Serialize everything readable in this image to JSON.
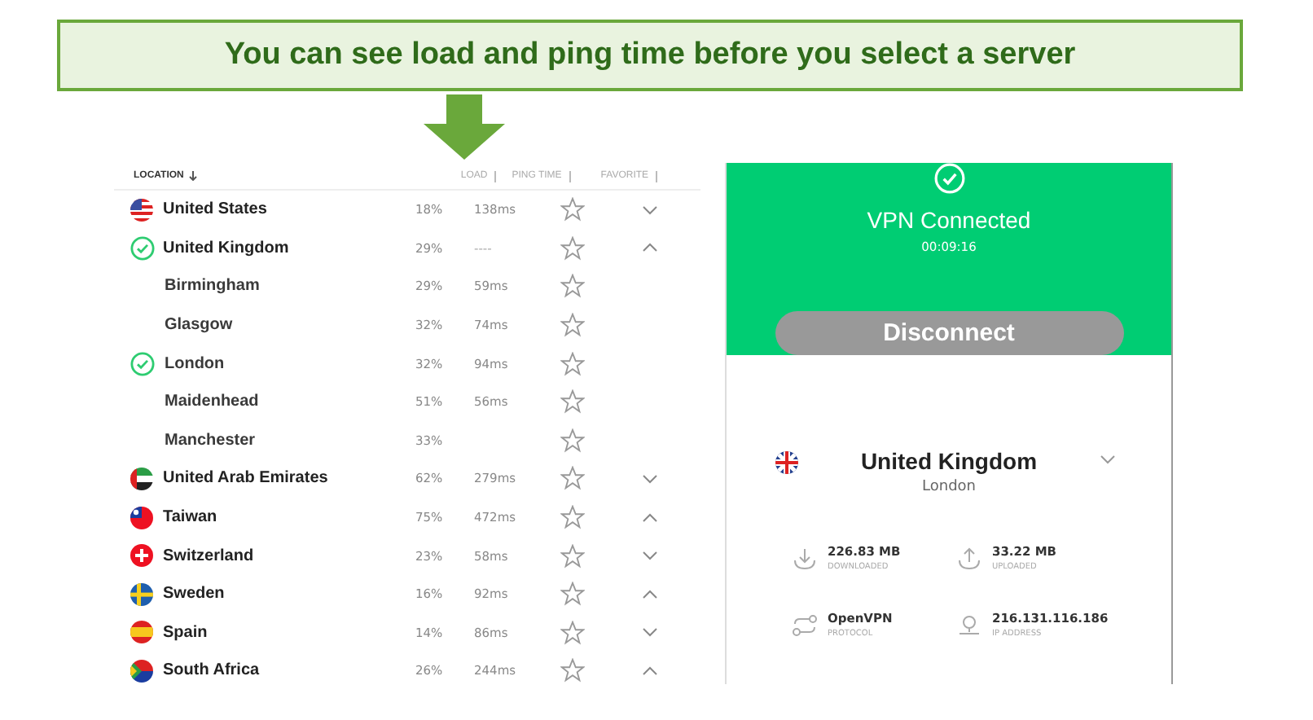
{
  "banner": {
    "text": "You can see load and ping time before you select a server"
  },
  "table": {
    "columns": [
      "LOCATION",
      "LOAD",
      "PING TIME",
      "FAVORITE"
    ],
    "rows": [
      {
        "kind": "country",
        "flag": {
          "kind": "us"
        },
        "name": "United States",
        "load": "18%",
        "ping": "138ms",
        "favorite": false,
        "connected": false,
        "expanded": false
      },
      {
        "kind": "country",
        "name": "United Kingdom",
        "load": "29%",
        "ping": "----",
        "favorite": false,
        "connected": true,
        "expanded": true,
        "children": [
          {
            "kind": "city",
            "name": "Birmingham",
            "load": "29%",
            "ping": "59ms",
            "favorite": false,
            "connected": false
          },
          {
            "kind": "city",
            "name": "Glasgow",
            "load": "32%",
            "ping": "74ms",
            "favorite": false,
            "connected": false
          },
          {
            "kind": "city",
            "name": "London",
            "load": "32%",
            "ping": "94ms",
            "favorite": false,
            "connected": true
          },
          {
            "kind": "city",
            "name": "Maidenhead",
            "load": "51%",
            "ping": "56ms",
            "favorite": false,
            "connected": false
          },
          {
            "kind": "city",
            "name": "Manchester",
            "load": "33%",
            "favorite": false,
            "connected": false
          }
        ]
      },
      {
        "kind": "country",
        "flag": {
          "kind": "ae"
        },
        "name": "United Arab Emirates",
        "load": "62%",
        "ping": "279ms",
        "favorite": false,
        "connected": false,
        "expanded": false
      },
      {
        "kind": "country",
        "flag": {
          "kind": "tw"
        },
        "name": "Taiwan",
        "load": "75%",
        "ping": "472ms",
        "favorite": false,
        "connected": false,
        "expanded": true
      },
      {
        "kind": "country",
        "flag": {
          "kind": "ch"
        },
        "name": "Switzerland",
        "load": "23%",
        "ping": "58ms",
        "favorite": false,
        "connected": false,
        "expanded": false
      },
      {
        "kind": "country",
        "flag": {
          "kind": "se"
        },
        "name": "Sweden",
        "load": "16%",
        "ping": "92ms",
        "favorite": false,
        "connected": false,
        "expanded": true
      },
      {
        "kind": "country",
        "flag": {
          "kind": "es"
        },
        "name": "Spain",
        "load": "14%",
        "ping": "86ms",
        "favorite": false,
        "connected": false,
        "expanded": false
      },
      {
        "kind": "country",
        "flag": {
          "kind": "za"
        },
        "name": "South Africa",
        "load": "26%",
        "ping": "244ms",
        "favorite": false,
        "connected": false,
        "expanded": true
      }
    ]
  },
  "status": {
    "title": "VPN Connected",
    "time": "00:09:16",
    "button": "Disconnect"
  },
  "location": {
    "flag": {
      "kind": "uk"
    },
    "country": "United Kingdom",
    "city": "London"
  },
  "stats": [
    {
      "kind": "download",
      "value": "226.83 MB",
      "label": "DOWNLOADED"
    },
    {
      "kind": "upload",
      "value": "33.22 MB",
      "label": "UPLOADED"
    },
    {
      "kind": "protocol",
      "value": "OpenVPN",
      "label": "PROTOCOL"
    },
    {
      "kind": "ip",
      "value": "216.131.116.186",
      "label": "IP ADDRESS"
    }
  ]
}
